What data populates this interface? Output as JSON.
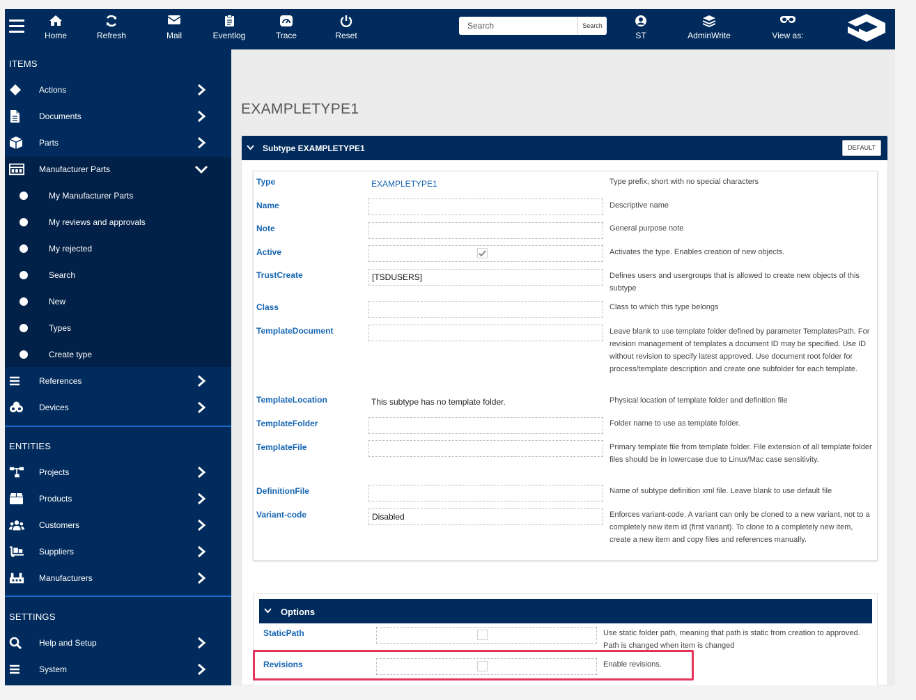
{
  "topbar": {
    "nav": [
      {
        "label": "Home",
        "icon": "home-icon"
      },
      {
        "label": "Refresh",
        "icon": "refresh-icon"
      },
      {
        "label": "Mail",
        "icon": "mail-icon"
      },
      {
        "label": "Eventlog",
        "icon": "clipboard-icon"
      },
      {
        "label": "Trace",
        "icon": "gauge-icon"
      },
      {
        "label": "Reset",
        "icon": "power-icon"
      }
    ],
    "search_placeholder": "Search",
    "search_button": "Search",
    "user": {
      "label": "ST",
      "icon": "user-icon"
    },
    "role": {
      "label": "AdminWrite",
      "icon": "layers-icon"
    },
    "view_as": {
      "label": "View as:",
      "icon": "glasses-icon"
    }
  },
  "sidebar": {
    "items_heading": "ITEMS",
    "items": [
      {
        "label": "Actions",
        "icon": "diamond-icon"
      },
      {
        "label": "Documents",
        "icon": "document-icon"
      },
      {
        "label": "Parts",
        "icon": "cube-icon"
      },
      {
        "label": "Manufacturer Parts",
        "icon": "factory-icon"
      }
    ],
    "sub_items": [
      "My Manufacturer Parts",
      "My reviews and approvals",
      "My rejected",
      "Search",
      "New",
      "Types",
      "Create type"
    ],
    "items_after": [
      {
        "label": "References",
        "icon": "list-icon"
      },
      {
        "label": "Devices",
        "icon": "devices-icon"
      }
    ],
    "entities_heading": "ENTITIES",
    "entities": [
      {
        "label": "Projects",
        "icon": "sitemap-icon"
      },
      {
        "label": "Products",
        "icon": "box-icon"
      },
      {
        "label": "Customers",
        "icon": "users-icon"
      },
      {
        "label": "Suppliers",
        "icon": "dolly-icon"
      },
      {
        "label": "Manufacturers",
        "icon": "industry-icon"
      }
    ],
    "settings_heading": "SETTINGS",
    "settings": [
      {
        "label": "Help and Setup",
        "icon": "search-icon"
      },
      {
        "label": "System",
        "icon": "list-icon"
      }
    ]
  },
  "main": {
    "title": "EXAMPLETYPE1",
    "panel_title": "Subtype EXAMPLETYPE1",
    "default_button": "DEFAULT",
    "fields": {
      "type": {
        "label": "Type",
        "value": "EXAMPLETYPE1",
        "desc": "Type prefix, short with no special characters"
      },
      "name": {
        "label": "Name",
        "value": "",
        "desc": "Descriptive name"
      },
      "note": {
        "label": "Note",
        "value": "",
        "desc": "General purpose note"
      },
      "active": {
        "label": "Active",
        "checked": true,
        "desc": "Activates the type. Enables creation of new objects."
      },
      "trustcreate": {
        "label": "TrustCreate",
        "value": "[TSDUSERS]",
        "desc": "Defines users and usergroups that is allowed to create new objects of this subtype"
      },
      "class": {
        "label": "Class",
        "value": "",
        "desc": "Class to which this type belongs"
      },
      "templatedocument": {
        "label": "TemplateDocument",
        "value": "",
        "desc": "Leave blank to use template folder defined by parameter TemplatesPath. For revision management of templates a document ID may be specified. Use ID without revision to specify latest approved. Use document root folder for process/template description and create one subfolder for each template."
      },
      "templatelocation": {
        "label": "TemplateLocation",
        "value": "This subtype has no template folder.",
        "desc": "Physical location of template folder and definition file"
      },
      "templatefolder": {
        "label": "TemplateFolder",
        "value": "",
        "desc": "Folder name to use as template folder."
      },
      "templatefile": {
        "label": "TemplateFile",
        "value": "",
        "desc": "Primary template file from template folder. File extension of all template folder files should be in lowercase due to Linux/Mac case sensitivity."
      },
      "definitionfile": {
        "label": "DefinitionFile",
        "value": "",
        "desc": "Name of subtype definition xml file. Leave blank to use default file"
      },
      "variantcode": {
        "label": "Variant-code",
        "value": "Disabled",
        "desc": "Enforces variant-code. A variant can only be cloned to a new variant, not to a completely new item id (first variant). To clone to a completely new item, create a new item and copy files and references manually."
      }
    },
    "options": {
      "title": "Options",
      "staticpath": {
        "label": "StaticPath",
        "checked": false,
        "desc": "Use static folder path, meaning that path is static from creation to approved. Path is changed when item is changed"
      },
      "revisions": {
        "label": "Revisions",
        "checked": false,
        "desc": "Enable revisions."
      }
    }
  },
  "colors": {
    "navy": "#002b5c",
    "sidebar_sub": "#022148",
    "link_blue": "#1766b3",
    "divider": "#1a67c9",
    "highlight": "#e5335a"
  }
}
